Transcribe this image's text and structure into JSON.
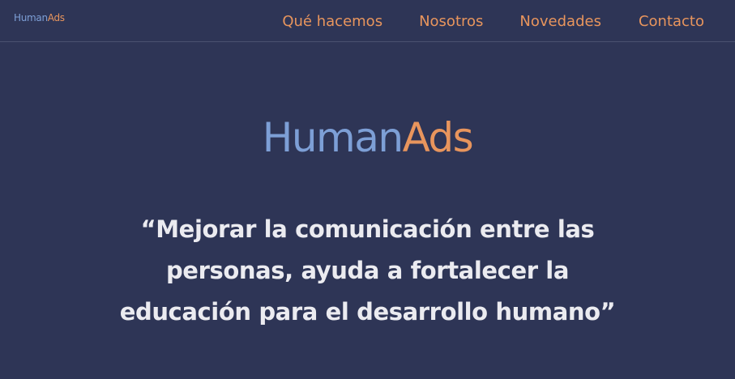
{
  "header": {
    "brand_part1": "Human",
    "brand_part2": "Ads",
    "nav": [
      {
        "label": "Qué hacemos"
      },
      {
        "label": "Nosotros"
      },
      {
        "label": "Novedades"
      },
      {
        "label": "Contacto"
      }
    ]
  },
  "hero": {
    "logo_part1": "Human",
    "logo_part2": "Ads",
    "quote": "“Mejorar la comunicación entre las personas, ayuda a fortalecer la educación para el desarrollo humano”"
  },
  "colors": {
    "background": "#2e3556",
    "accent_orange": "#e8955d",
    "accent_blue": "#7d9fd6",
    "quote_text": "#ebebf0"
  }
}
